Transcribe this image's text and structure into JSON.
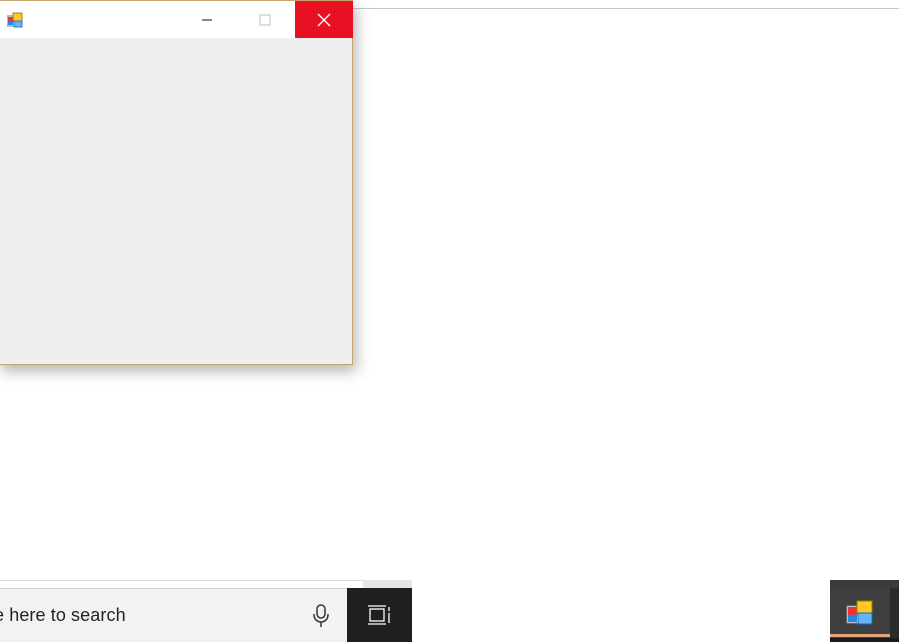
{
  "window": {
    "title": "",
    "icon": "app-window-icon",
    "buttons": {
      "minimize": "minimize-icon",
      "maximize": "maximize-icon",
      "close": "close-icon"
    },
    "close_color": "#e81123",
    "client_color": "#efefef"
  },
  "taskbar": {
    "search": {
      "text": "e here to search",
      "icon": "microphone-icon"
    },
    "task_view_icon": "task-view-icon",
    "pinned_app_icon": "app-window-icon",
    "active_indicator_color": "#e6a47a"
  }
}
